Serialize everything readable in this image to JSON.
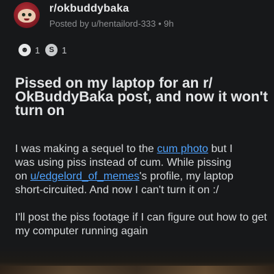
{
  "header": {
    "subreddit": "r/okbuddybaka",
    "meta": "Posted by u/hentailord-333 • 9h"
  },
  "awards": [
    {
      "icon": "helpful-award-icon",
      "count": "1"
    },
    {
      "icon": "silver-award-icon",
      "count": "1"
    }
  ],
  "post": {
    "title_lines": [
      "Pissed on my laptop for an r/",
      "OkBuddyBaka post, and now it won't",
      "turn on"
    ],
    "paragraph1": {
      "l1_a": "I was making a sequel to the ",
      "l1_link": "cum photo",
      "l1_b": " but I",
      "l2": "was using piss instead of cum. While pissing",
      "l3_a": "on ",
      "l3_link": "u/edgelord_of_memes",
      "l3_b": "'s profile, my laptop",
      "l4": "short-circuited. And now I can't turn it on :/"
    },
    "paragraph2": {
      "l1": "I'll post the piss footage if I can figure out how to get",
      "l2": "my computer running again"
    }
  },
  "colors": {
    "background": "#17181a",
    "link": "#4fa3ff"
  }
}
